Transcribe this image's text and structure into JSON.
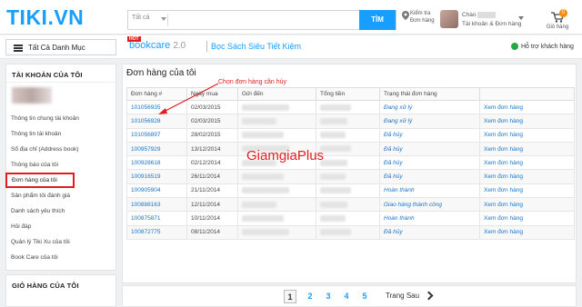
{
  "header": {
    "logo": "TIKI.VN",
    "search_category": "Tất cả",
    "search_placeholder": "",
    "search_button": "TÌM",
    "track_order": "Kiểm tra\nĐơn hàng",
    "greeting": "Chào",
    "account_label": "Tài khoản & Đơn hàng",
    "cart_count": "0",
    "cart_label": "Giỏ hàng"
  },
  "subbar": {
    "categories_button": "Tất Cả Danh Mục",
    "hot_badge": "HOT",
    "bookcare_name": "bookcare",
    "bookcare_version": "2.0",
    "bookcare_tagline": "Bọc Sách Siêu Tiết Kiệm",
    "support": "Hỗ trợ khách hàng"
  },
  "sidebar": {
    "heading": "TÀI KHOẢN CỦA TÔI",
    "items": [
      "Thông tin chung tài khoản",
      "Thông tin tài khoản",
      "Sổ địa chỉ (Address book)",
      "Thông báo của tôi",
      "Đơn hàng của tôi",
      "Sản phẩm tôi đánh giá",
      "Danh sách yêu thích",
      "Hỏi đáp",
      "Quản lý Tiki Xu của tôi",
      "Book Care của tôi"
    ],
    "active_index": 4,
    "cart_heading": "GIỎ HÀNG CỦA TÔI"
  },
  "main": {
    "title": "Đơn hàng của tôi",
    "columns": [
      "Đơn hàng #",
      "Ngày mua",
      "Gửi đến",
      "Tổng tiền",
      "Trạng thái đơn hàng",
      ""
    ],
    "rows": [
      {
        "id": "101056935",
        "date": "02/03/2015",
        "status": "Đang xử lý",
        "action": "Xem đơn hàng"
      },
      {
        "id": "101056928",
        "date": "02/03/2015",
        "status": "Đang xử lý",
        "action": "Xem đơn hàng"
      },
      {
        "id": "101056897",
        "date": "28/02/2015",
        "status": "Đã hủy",
        "action": "Xem đơn hàng"
      },
      {
        "id": "100957929",
        "date": "13/12/2014",
        "status": "Đã hủy",
        "action": "Xem đơn hàng"
      },
      {
        "id": "100928618",
        "date": "02/12/2014",
        "status": "Đã hủy",
        "action": "Xem đơn hàng"
      },
      {
        "id": "100916519",
        "date": "26/11/2014",
        "status": "Đã hủy",
        "action": "Xem đơn hàng"
      },
      {
        "id": "100905904",
        "date": "21/11/2014",
        "status": "Hoàn thành",
        "action": "Xem đơn hàng"
      },
      {
        "id": "100888163",
        "date": "12/11/2014",
        "status": "Giao hàng thành công",
        "action": "Xem đơn hàng"
      },
      {
        "id": "100875871",
        "date": "10/11/2014",
        "status": "Hoàn thành",
        "action": "Xem đơn hàng"
      },
      {
        "id": "100872775",
        "date": "08/11/2014",
        "status": "Đã hủy",
        "action": "Xem đơn hàng"
      }
    ],
    "annotation": "Chọn đơn hàng cần hủy",
    "watermark": "GiamgiaPlus"
  },
  "pager": {
    "pages": [
      "1",
      "2",
      "3",
      "4",
      "5"
    ],
    "current": "1",
    "next_label": "Trang Sau"
  },
  "colors": {
    "brand": "#189eff",
    "accent_red": "#e21d1d",
    "link": "#1a73c8"
  }
}
